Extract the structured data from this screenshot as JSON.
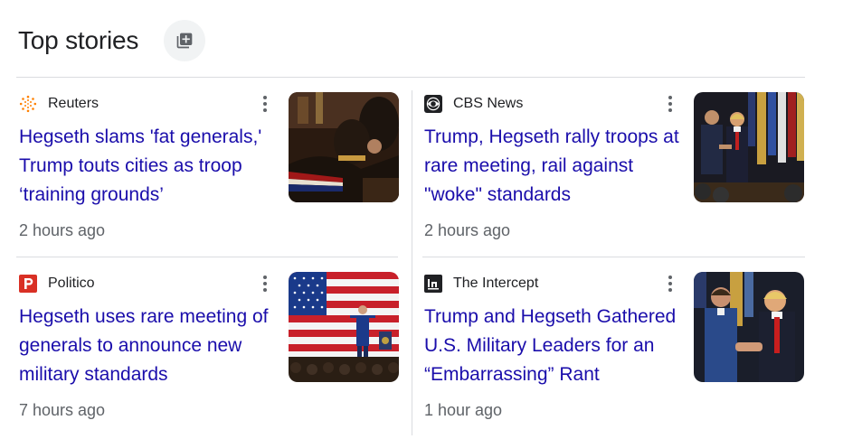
{
  "header": {
    "title": "Top stories",
    "button_icon": "add-to-collection-icon"
  },
  "stories": [
    {
      "source": "Reuters",
      "logo_icon": "reuters-logo-icon",
      "headline": "Hegseth slams 'fat generals,' Trump touts cities as troop ‘training grounds’",
      "time": "2 hours ago",
      "image": "generals-seated-audience-photo"
    },
    {
      "source": "CBS News",
      "logo_icon": "cbs-eye-logo-icon",
      "headline": "Trump, Hegseth rally troops at rare meeting, rail against \"woke\" standards",
      "time": "2 hours ago",
      "image": "trump-hegseth-handshake-flags-photo"
    },
    {
      "source": "Politico",
      "logo_icon": "politico-p-logo-icon",
      "headline": "Hegseth uses rare meeting of generals to announce new military standards",
      "time": "7 hours ago",
      "image": "speaker-on-stage-american-flag-photo"
    },
    {
      "source": "The Intercept",
      "logo_icon": "intercept-logo-icon",
      "headline": "Trump and Hegseth Gathered U.S. Military Leaders for an “Embarrassing” Rant",
      "time": "1 hour ago",
      "image": "trump-hegseth-handshake-photo"
    }
  ],
  "colors": {
    "headline": "#1a0dab",
    "meta": "#5f6368",
    "divider": "#dadce0",
    "politico": "#d93025",
    "reuters": "#ff8000"
  }
}
